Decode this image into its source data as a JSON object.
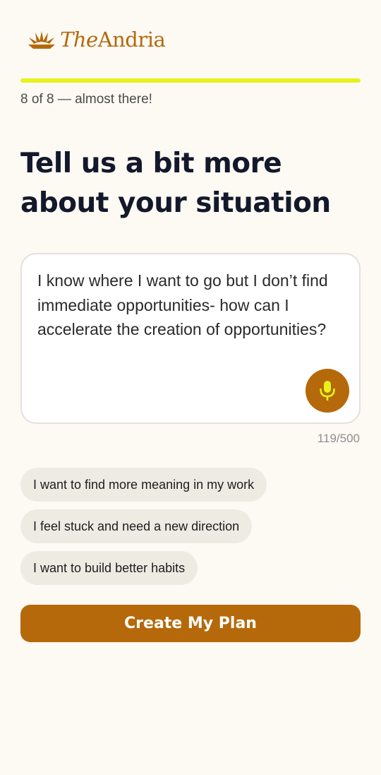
{
  "brand": {
    "name_part1": "The",
    "name_part2": "Andria",
    "color": "#b5690b"
  },
  "progress": {
    "label": "8 of 8 — almost there!",
    "fraction": 1.0,
    "color": "#e6f21a"
  },
  "question": {
    "title": "Tell us a bit more about your situation"
  },
  "response": {
    "value": "I know where I want to go but I don’t find immediate opportunities- how can I accelerate the creation of opportunities?",
    "char_count": "119/500",
    "mic_icon": "microphone-icon"
  },
  "suggestions": [
    {
      "label": "I want to find more meaning in my work"
    },
    {
      "label": "I feel stuck and need a new direction"
    },
    {
      "label": "I want to build better habits"
    }
  ],
  "cta": {
    "label": "Create My Plan",
    "color": "#b5690b"
  }
}
